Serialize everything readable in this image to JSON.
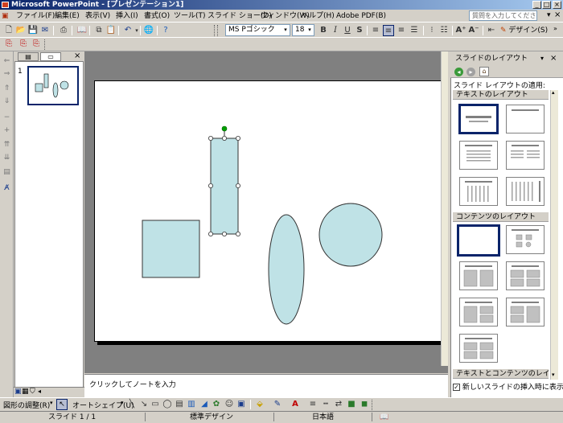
{
  "title_bar": {
    "title": "Microsoft PowerPoint - [プレゼンテーション1]"
  },
  "menu": {
    "items": [
      "ファイル(F)",
      "編集(E)",
      "表示(V)",
      "挿入(I)",
      "書式(O)",
      "ツール(T)",
      "スライド ショー(D)",
      "ウィンドウ(W)",
      "ヘルプ(H)",
      "Adobe PDF(B)"
    ],
    "help_placeholder": "質問を入力してください"
  },
  "format_toolbar": {
    "font_name": "MS Pゴシック",
    "font_size": "18",
    "design_label": "デザイン(S)"
  },
  "outline": {
    "slide_number": "1"
  },
  "notes": {
    "placeholder": "クリックしてノートを入力"
  },
  "task_pane": {
    "title": "スライドのレイアウト",
    "apply_label": "スライド レイアウトの適用:",
    "section_text": "テキストのレイアウト",
    "section_content": "コンテンツのレイアウト",
    "section_text_content": "テキストとコンテンツのレイアウト",
    "checkbox_label": "新しいスライドの挿入時に表示する"
  },
  "drawing_toolbar": {
    "draw_label": "図形の調整(R)",
    "autoshape_label": "オートシェイプ(U)"
  },
  "status_bar": {
    "slide": "スライド 1 / 1",
    "design": "標準デザイン",
    "language": "日本語"
  },
  "colors": {
    "shape_fill": "#bfe2e6",
    "title_gradient_start": "#0a246a",
    "selection_handle": "#00a000"
  }
}
